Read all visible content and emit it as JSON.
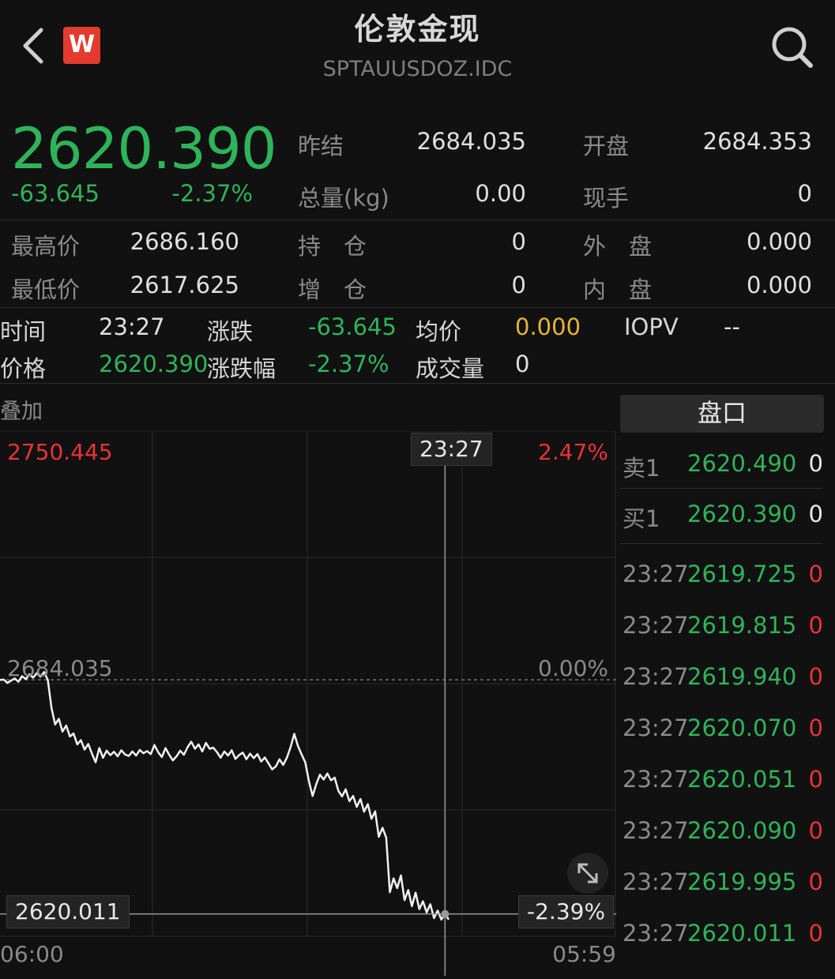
{
  "header": {
    "title": "伦敦金现",
    "subtitle": "SPTAUUSDOZ.IDC",
    "logo_letter": "W",
    "back_icon": "chevron-left-icon",
    "search_icon": "search-icon"
  },
  "quote": {
    "last_price": "2620.390",
    "change": "-63.645",
    "change_pct": "-2.37%",
    "fields": {
      "prev_settle_label": "昨结",
      "prev_settle": "2684.035",
      "open_label": "开盘",
      "open": "2684.353",
      "volume_label": "总量(kg)",
      "volume": "0.00",
      "current_hand_label": "现手",
      "current_hand": "0",
      "high_label": "最高价",
      "high": "2686.160",
      "low_label": "最低价",
      "low": "2617.625",
      "open_interest_label": "持　仓",
      "open_interest": "0",
      "oi_change_label": "增　仓",
      "oi_change": "0",
      "outer_label": "外　盘",
      "outer": "0.000",
      "inner_label": "内　盘",
      "inner": "0.000"
    }
  },
  "crosshair": {
    "time_label": "时间",
    "time": "23:27",
    "change_label": "涨跌",
    "change": "-63.645",
    "avg_label": "均价",
    "avg": "0.000",
    "iopv_label": "IOPV",
    "iopv": "--",
    "price_label": "价格",
    "price": "2620.390",
    "change_pct_label": "涨跌幅",
    "change_pct": "-2.37%",
    "turnover_label": "成交量",
    "turnover": "0"
  },
  "chart": {
    "overlay_label": "叠加",
    "y_top": "2750.445",
    "y_top_pct": "2.47%",
    "y_mid": "2684.035",
    "y_mid_pct": "0.00%",
    "cursor_time": "23:27",
    "cursor_price": "2620.011",
    "cursor_pct": "-2.39%",
    "x_start": "06:00",
    "x_end": "05:59",
    "expand_icon": "expand-arrows-icon"
  },
  "chart_data": {
    "type": "line",
    "series": [
      {
        "values": [
          2684.0,
          2684.1,
          2683.2,
          2683.8,
          2684.4,
          2683.5,
          2685.0,
          2684.2,
          2685.5,
          2684.6,
          2685.8,
          2684.9,
          2686.1,
          2684.0,
          2676.5,
          2672.1,
          2673.6,
          2670.2,
          2671.8,
          2668.9,
          2669.7,
          2666.8,
          2667.9,
          2665.4,
          2666.9,
          2664.3,
          2662.0,
          2665.8,
          2663.2,
          2665.1,
          2663.9,
          2664.8,
          2663.6,
          2665.2,
          2664.1,
          2663.7,
          2664.9,
          2663.8,
          2665.3,
          2664.4,
          2665.0,
          2664.2,
          2666.6,
          2664.7,
          2663.4,
          2665.8,
          2664.0,
          2662.5,
          2663.6,
          2665.1,
          2664.0,
          2666.0,
          2667.5,
          2665.6,
          2666.8,
          2664.9,
          2667.2,
          2665.6,
          2665.9,
          2664.7,
          2663.2,
          2664.9,
          2663.8,
          2665.2,
          2662.9,
          2663.9,
          2664.6,
          2662.8,
          2664.3,
          2663.1,
          2664.2,
          2662.2,
          2663.3,
          2661.7,
          2660.1,
          2660.9,
          2662.8,
          2661.3,
          2663.2,
          2666.0,
          2669.6,
          2666.4,
          2664.1,
          2662.0,
          2656.9,
          2653.0,
          2656.2,
          2658.7,
          2657.4,
          2659.0,
          2657.2,
          2657.9,
          2654.4,
          2652.9,
          2654.8,
          2651.6,
          2653.0,
          2650.1,
          2652.2,
          2648.8,
          2650.8,
          2646.9,
          2648.9,
          2642.1,
          2644.5,
          2641.9,
          2627.3,
          2631.0,
          2628.4,
          2631.8,
          2625.2,
          2627.9,
          2623.6,
          2627.2,
          2622.8,
          2624.9,
          2621.9,
          2624.1,
          2620.4,
          2622.4,
          2620.0,
          2621.5,
          2620.0
        ]
      }
    ],
    "y_range": [
      2617.625,
      2750.445
    ],
    "prev_close": 2684.035,
    "cursor_index": 121
  },
  "orderbook": {
    "tab_label": "盘口",
    "sell1_label": "卖1",
    "sell1_price": "2620.490",
    "sell1_vol": "0",
    "buy1_label": "买1",
    "buy1_price": "2620.390",
    "buy1_vol": "0",
    "ticks": [
      {
        "time": "23:27",
        "price": "2619.725",
        "vol": "0"
      },
      {
        "time": "23:27",
        "price": "2619.815",
        "vol": "0"
      },
      {
        "time": "23:27",
        "price": "2619.940",
        "vol": "0"
      },
      {
        "time": "23:27",
        "price": "2620.070",
        "vol": "0"
      },
      {
        "time": "23:27",
        "price": "2620.051",
        "vol": "0"
      },
      {
        "time": "23:27",
        "price": "2620.090",
        "vol": "0"
      },
      {
        "time": "23:27",
        "price": "2619.995",
        "vol": "0"
      },
      {
        "time": "23:27",
        "price": "2620.011",
        "vol": "0"
      }
    ]
  },
  "colors": {
    "up": "#e8333a",
    "down": "#2fb35a",
    "neutral": "#e6b43a",
    "bg": "#111111"
  }
}
